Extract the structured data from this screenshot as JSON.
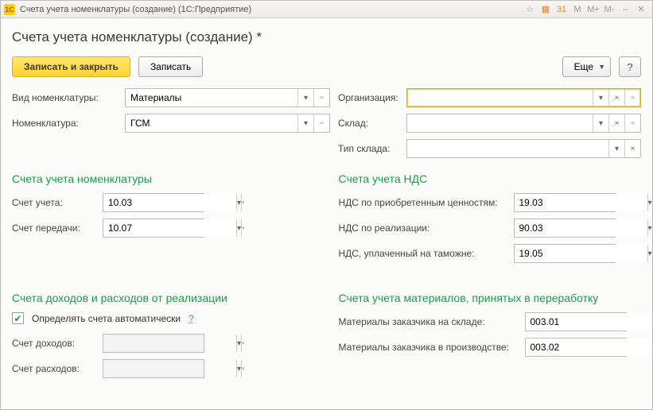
{
  "titlebar": {
    "app_icon_text": "1C",
    "title": "Счета учета номенклатуры (создание)  (1С:Предприятие)",
    "buttons": {
      "m": "M",
      "mplus": "M+",
      "mminus": "M-",
      "minimize": "–",
      "close": "✕"
    }
  },
  "page_title": "Счета учета номенклатуры (создание) *",
  "toolbar": {
    "save_close": "Записать и закрыть",
    "save": "Записать",
    "more": "Еще",
    "help": "?"
  },
  "top_fields": {
    "nomenclature_kind_label": "Вид номенклатуры:",
    "nomenclature_kind_value": "Материалы",
    "nomenclature_label": "Номенклатура:",
    "nomenclature_value": "ГСМ",
    "organization_label": "Организация:",
    "organization_value": "",
    "warehouse_label": "Склад:",
    "warehouse_value": "",
    "warehouse_type_label": "Тип склада:",
    "warehouse_type_value": ""
  },
  "sections": {
    "accounts_nomen": "Счета учета номенклатуры",
    "accounts_vat": "Счета учета НДС",
    "income_expense": "Счета доходов и расходов от реализации",
    "materials_processing": "Счета учета материалов, принятых в переработку"
  },
  "accounts": {
    "account_label": "Счет учета:",
    "account_value": "10.03",
    "transfer_label": "Счет передачи:",
    "transfer_value": "10.07",
    "vat_purchase_label": "НДС по приобретенным ценностям:",
    "vat_purchase_value": "19.03",
    "vat_sale_label": "НДС по реализации:",
    "vat_sale_value": "90.03",
    "vat_customs_label": "НДС, уплаченный на таможне:",
    "vat_customs_value": "19.05"
  },
  "income_expense": {
    "auto_checkbox_label": "Определять счета автоматически",
    "auto_help": "?",
    "income_label": "Счет доходов:",
    "expense_label": "Счет расходов:"
  },
  "materials": {
    "in_stock_label": "Материалы заказчика на складе:",
    "in_stock_value": "003.01",
    "in_production_label": "Материалы заказчика в производстве:",
    "in_production_value": "003.02"
  },
  "glyphs": {
    "dropdown": "▾",
    "open": "▫",
    "clear": "×",
    "check": "✔"
  }
}
